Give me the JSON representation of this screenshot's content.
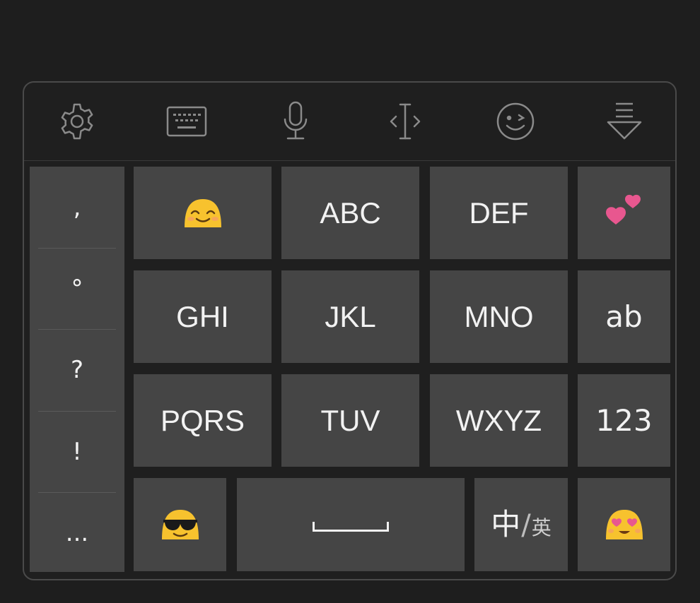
{
  "toolbar": {
    "items": [
      {
        "icon": "gear-icon"
      },
      {
        "icon": "keyboard-icon"
      },
      {
        "icon": "microphone-icon"
      },
      {
        "icon": "cursor-move-icon"
      },
      {
        "icon": "wink-face-icon"
      },
      {
        "icon": "hide-keyboard-icon"
      }
    ]
  },
  "punctuation": [
    ",",
    "°",
    "?",
    "!",
    "..."
  ],
  "keys": {
    "row1": {
      "emoji_left": "smiling-blush-emoji",
      "k1": "ABC",
      "k2": "DEF",
      "emoji_right": "two-hearts-emoji"
    },
    "row2": {
      "k0": "GHI",
      "k1": "JKL",
      "k2": "MNO",
      "mode_ab": "ab"
    },
    "row3": {
      "k0": "PQRS",
      "k1": "TUV",
      "k2": "WXYZ",
      "mode_123": "123"
    },
    "row4": {
      "emoji_left": "sunglasses-emoji",
      "space": "space-bar-icon",
      "lang_big": "中",
      "lang_slash": "/",
      "lang_small": "英",
      "emoji_right": "heart-eyes-emoji"
    }
  },
  "colors": {
    "background": "#1e1e1e",
    "key": "#454545",
    "text": "#f2f2f2",
    "icon": "#8a8a8a",
    "emoji_yellow": "#f7c22e",
    "heart_pink": "#e8578f"
  }
}
